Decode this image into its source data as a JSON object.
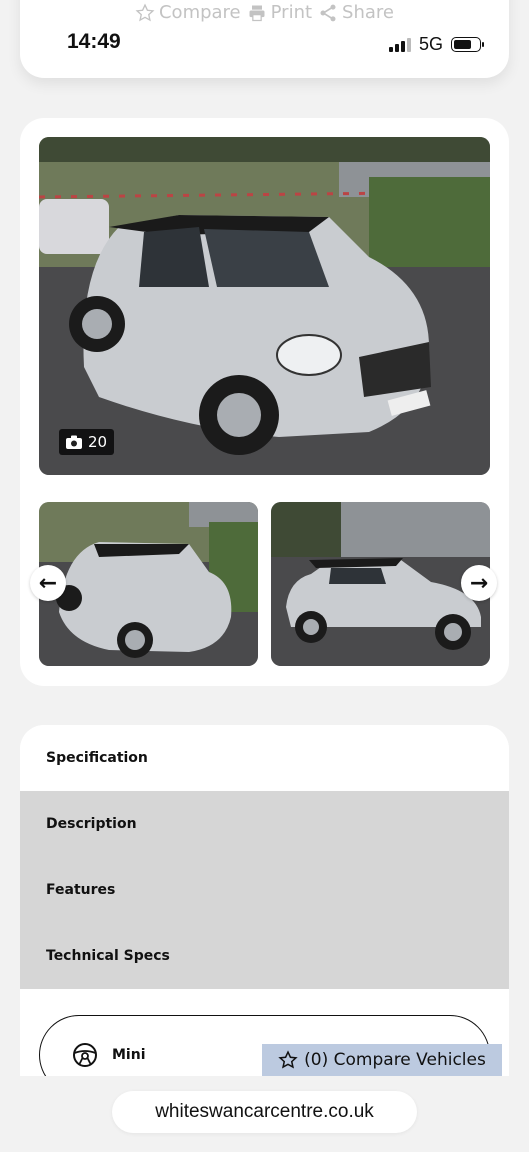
{
  "status_bar": {
    "time": "14:49",
    "network": "5G"
  },
  "top_actions": {
    "compare": "Compare",
    "print": "Print",
    "share": "Share"
  },
  "gallery": {
    "photo_count": "20",
    "prev_arrow": "←",
    "next_arrow": "→"
  },
  "tabs": [
    {
      "label": "Specification"
    },
    {
      "label": "Description"
    },
    {
      "label": "Features"
    },
    {
      "label": "Technical Specs"
    }
  ],
  "vehicle": {
    "make": "Mini"
  },
  "compare_bar": {
    "label": "(0) Compare Vehicles"
  },
  "browser": {
    "url": "whiteswancarcentre.co.uk"
  },
  "colors": {
    "compare_bar_bg": "#bccae0",
    "tab_gray": "#d6d6d6",
    "car_silver": "#c9ccd0"
  }
}
